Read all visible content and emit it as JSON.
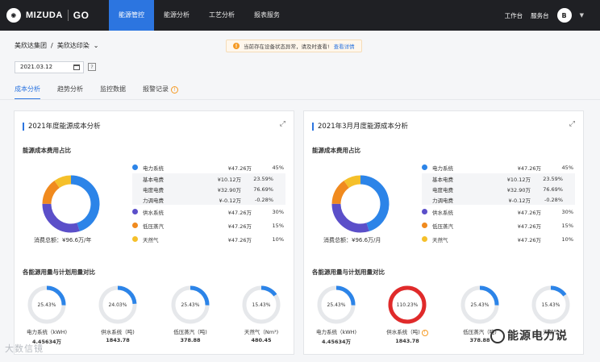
{
  "header": {
    "brand": "MIZUDA",
    "brand_mark": "GO",
    "nav": [
      "能源管控",
      "能源分析",
      "工艺分析",
      "报表服务"
    ],
    "right": [
      "工作台",
      "服务台"
    ],
    "avatar": "B"
  },
  "breadcrumb": {
    "org": "美欣达集团",
    "sep": "/",
    "company": "美欣达印染",
    "caret": "⌄"
  },
  "alert": {
    "icon": "!",
    "text": "当前存在设备状态异常，请及时查看!",
    "link": "查看详情"
  },
  "date": {
    "value": "2021.03.12",
    "help": "?"
  },
  "tabs": [
    "成本分析",
    "趋势分析",
    "监控数据",
    "报警记录"
  ],
  "cards": [
    {
      "title": "2021年度能源成本分析",
      "sec1": "能源成本费用占比",
      "total": "消费总额：¥96.6万/年",
      "sec2": "各能源用量与计划用量对比",
      "legend": [
        {
          "name": "电力系统",
          "value": "¥47.26万",
          "pct": "45%",
          "color": "#2c84e8"
        }
      ],
      "sub": [
        {
          "name": "基本电费",
          "value": "¥10.12万",
          "pct": "23.59%"
        },
        {
          "name": "电度电费",
          "value": "¥32.90万",
          "pct": "76.69%"
        },
        {
          "name": "力调电费",
          "value": "¥-0.12万",
          "pct": "-0.28%"
        }
      ],
      "legend2": [
        {
          "name": "供水系统",
          "value": "¥47.26万",
          "pct": "30%",
          "color": "#5b4fc9"
        },
        {
          "name": "低压蒸汽",
          "value": "¥47.26万",
          "pct": "15%",
          "color": "#f08a1e"
        },
        {
          "name": "天然气",
          "value": "¥47.26万",
          "pct": "10%",
          "color": "#f5c02a"
        }
      ],
      "gauges": [
        {
          "pct": "25.43%",
          "label": "电力系统（kWH)",
          "value": "4.45634万",
          "ratio": 0.2543,
          "color": "#2c84e8"
        },
        {
          "pct": "24.03%",
          "label": "供水系统（吨)",
          "value": "1843.78",
          "ratio": 0.2403,
          "color": "#2c84e8"
        },
        {
          "pct": "25.43%",
          "label": "低压蒸汽（吨)",
          "value": "378.88",
          "ratio": 0.2543,
          "color": "#2c84e8"
        },
        {
          "pct": "15.43%",
          "label": "天然气（Nm³)",
          "value": "480.45",
          "ratio": 0.1543,
          "color": "#2c84e8"
        }
      ]
    },
    {
      "title": "2021年3月月度能源成本分析",
      "sec1": "能源成本费用占比",
      "total": "消费总额：¥96.6万/月",
      "sec2": "各能源用量与计划用量对比",
      "legend": [
        {
          "name": "电力系统",
          "value": "¥47.26万",
          "pct": "45%",
          "color": "#2c84e8"
        }
      ],
      "sub": [
        {
          "name": "基本电费",
          "value": "¥10.12万",
          "pct": "23.59%"
        },
        {
          "name": "电度电费",
          "value": "¥32.90万",
          "pct": "76.69%"
        },
        {
          "name": "力调电费",
          "value": "¥-0.12万",
          "pct": "-0.28%"
        }
      ],
      "legend2": [
        {
          "name": "供水系统",
          "value": "¥47.26万",
          "pct": "30%",
          "color": "#5b4fc9"
        },
        {
          "name": "低压蒸汽",
          "value": "¥47.26万",
          "pct": "15%",
          "color": "#f08a1e"
        },
        {
          "name": "天然气",
          "value": "¥47.26万",
          "pct": "10%",
          "color": "#f5c02a"
        }
      ],
      "gauges": [
        {
          "pct": "25.43%",
          "label": "电力系统（kWH)",
          "value": "4.45634万",
          "ratio": 0.2543,
          "color": "#2c84e8"
        },
        {
          "pct": "110.23%",
          "label": "供水系统（吨)",
          "value": "1843.78",
          "ratio": 1.0,
          "color": "#e02a2a",
          "warn": "!"
        },
        {
          "pct": "25.43%",
          "label": "低压蒸汽（吨)",
          "value": "378.88",
          "ratio": 0.2543,
          "color": "#2c84e8"
        },
        {
          "pct": "15.43%",
          "label": "天然气",
          "value": "",
          "ratio": 0.1543,
          "color": "#2c84e8"
        }
      ]
    }
  ],
  "donut": {
    "segments": [
      {
        "name": "电力系统",
        "pct": 45,
        "color": "#2c84e8"
      },
      {
        "name": "供水系统",
        "pct": 30,
        "color": "#5b4fc9"
      },
      {
        "name": "低压蒸汽",
        "pct": 15,
        "color": "#f08a1e"
      },
      {
        "name": "天然气",
        "pct": 10,
        "color": "#f5c02a"
      }
    ]
  },
  "watermarks": {
    "left": "大数信镜",
    "right": "能源电力说"
  }
}
